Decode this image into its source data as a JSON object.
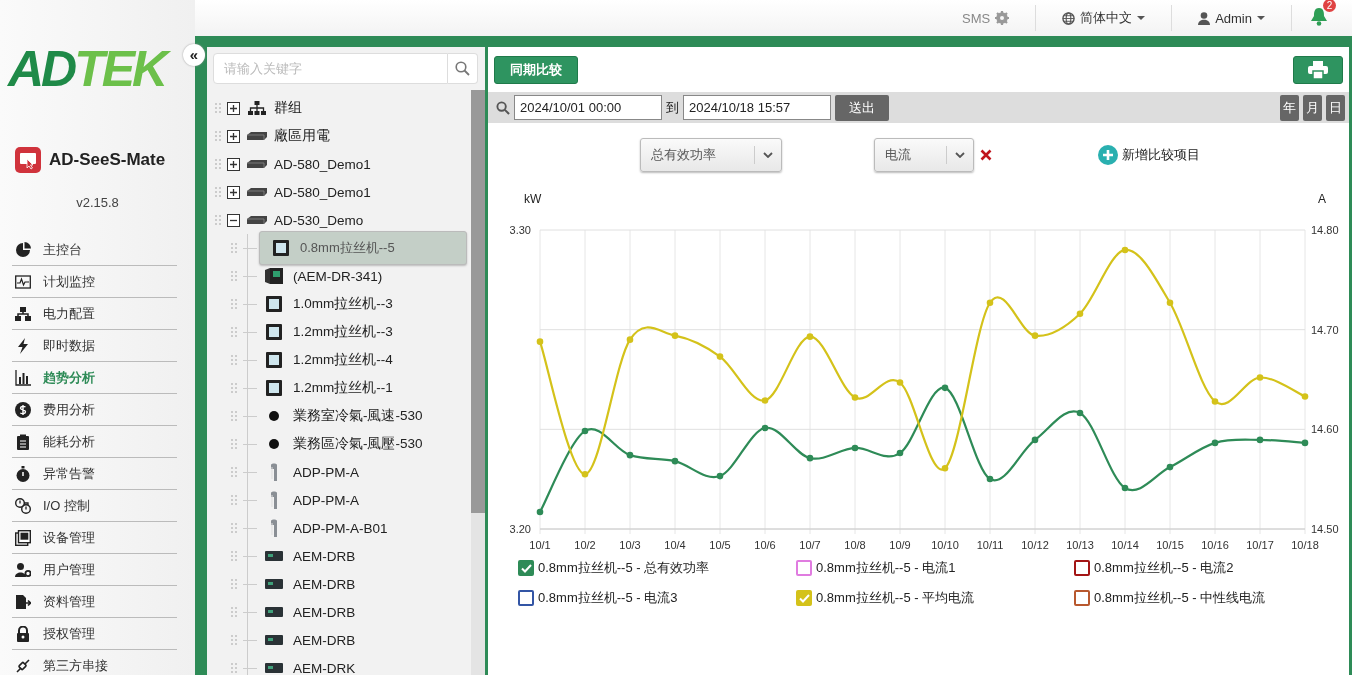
{
  "header": {
    "sms": "SMS",
    "language": "简体中文",
    "user": "Admin",
    "notifications": "2"
  },
  "sidebar": {
    "logo": [
      "AD",
      "TEK"
    ],
    "collapse": "«",
    "app_name": "AD-SeeS-Mate",
    "version": "v2.15.8",
    "items": [
      {
        "label": "主控台",
        "selected": false
      },
      {
        "label": "计划监控",
        "selected": false
      },
      {
        "label": "电力配置",
        "selected": false
      },
      {
        "label": "即时数据",
        "selected": false
      },
      {
        "label": "趋势分析",
        "selected": true
      },
      {
        "label": "费用分析",
        "selected": false
      },
      {
        "label": "能耗分析",
        "selected": false
      },
      {
        "label": "异常告警",
        "selected": false
      },
      {
        "label": "I/O 控制",
        "selected": false
      },
      {
        "label": "设备管理",
        "selected": false
      },
      {
        "label": "用户管理",
        "selected": false
      },
      {
        "label": "资料管理",
        "selected": false
      },
      {
        "label": "授权管理",
        "selected": false
      },
      {
        "label": "第三方串接",
        "selected": false
      }
    ]
  },
  "tree": {
    "search": {
      "placeholder": "请输入关键字"
    },
    "items": [
      {
        "label": "群组",
        "kind": "group",
        "expanded": false,
        "selected": false
      },
      {
        "label": "廠區用電",
        "kind": "device",
        "expanded": false,
        "selected": false
      },
      {
        "label": "AD-580_Demo1",
        "kind": "device",
        "expanded": false,
        "selected": false
      },
      {
        "label": "AD-580_Demo1",
        "kind": "device",
        "expanded": false,
        "selected": false
      },
      {
        "label": "AD-530_Demo",
        "kind": "device",
        "expanded": true,
        "selected": false,
        "children": [
          {
            "label": "0.8mm拉丝机--5",
            "kind": "meter",
            "selected": true
          },
          {
            "label": "(AEM-DR-341)",
            "kind": "panel",
            "selected": false
          },
          {
            "label": "1.0mm拉丝机--3",
            "kind": "meter",
            "selected": false
          },
          {
            "label": "1.2mm拉丝机--3",
            "kind": "meter",
            "selected": false
          },
          {
            "label": "1.2mm拉丝机--4",
            "kind": "meter",
            "selected": false
          },
          {
            "label": "1.2mm拉丝机--1",
            "kind": "meter",
            "selected": false
          },
          {
            "label": "業務室冷氣-風速-530",
            "kind": "dot",
            "selected": false
          },
          {
            "label": "業務區冷氣-風壓-530",
            "kind": "dot",
            "selected": false
          },
          {
            "label": "ADP-PM-A",
            "kind": "sensor",
            "selected": false
          },
          {
            "label": "ADP-PM-A",
            "kind": "sensor",
            "selected": false
          },
          {
            "label": "ADP-PM-A-B01",
            "kind": "sensor",
            "selected": false
          },
          {
            "label": "AEM-DRB",
            "kind": "module",
            "selected": false
          },
          {
            "label": "AEM-DRB",
            "kind": "module",
            "selected": false
          },
          {
            "label": "AEM-DRB",
            "kind": "module",
            "selected": false
          },
          {
            "label": "AEM-DRB",
            "kind": "module",
            "selected": false
          },
          {
            "label": "AEM-DRK",
            "kind": "module",
            "selected": false
          }
        ]
      }
    ]
  },
  "main": {
    "compare_button": "同期比较",
    "filter": {
      "from": "2024/10/01 00:00",
      "to_label": "到",
      "to": "2024/10/18 15:57",
      "submit": "送出",
      "periods": [
        "年",
        "月",
        "日"
      ]
    },
    "selectors": [
      {
        "value": "总有效功率",
        "removable": false
      },
      {
        "value": "电流",
        "removable": true
      }
    ],
    "add_item": "新增比较项目",
    "chart_data": {
      "type": "line",
      "grid": true,
      "ylabel": "kW",
      "y2label": "A",
      "ylim": [
        3.2,
        3.3
      ],
      "yticks": [
        {
          "value": 3.2,
          "label": "3.20"
        },
        {
          "value": 3.3,
          "label": "3.30"
        }
      ],
      "y2lim": [
        14.5,
        14.8
      ],
      "y2ticks": [
        {
          "value": 14.5,
          "label": "14.50"
        },
        {
          "value": 14.6,
          "label": "14.60"
        },
        {
          "value": 14.7,
          "label": "14.70"
        },
        {
          "value": 14.8,
          "label": "14.80"
        }
      ],
      "categories": [
        "10/1",
        "10/2",
        "10/3",
        "10/4",
        "10/5",
        "10/6",
        "10/7",
        "10/8",
        "10/9",
        "10/10",
        "10/11",
        "10/12",
        "10/13",
        "10/14",
        "10/15",
        "10/16",
        "10/17",
        "10/18"
      ],
      "series": [
        {
          "color": "#2e8b57",
          "marker": "circle",
          "values": [
            3.2057,
            3.2328,
            3.2247,
            3.2227,
            3.2177,
            3.2338,
            3.2237,
            3.2271,
            3.2254,
            3.2472,
            3.2167,
            3.2298,
            3.2388,
            3.2137,
            3.2207,
            3.2288,
            3.2298,
            3.2288
          ]
        },
        {
          "color": "#d4c21a",
          "axis": "y2",
          "marker": "circle",
          "values": [
            14.688,
            14.555,
            14.69,
            14.694,
            14.673,
            14.629,
            14.693,
            14.632,
            14.647,
            14.561,
            14.727,
            14.694,
            14.716,
            14.78,
            14.727,
            14.628,
            14.652,
            14.633
          ]
        }
      ]
    },
    "legend": [
      {
        "label": "0.8mm拉丝机--5 - 总有效功率",
        "color": "#2e8b57",
        "checked": true
      },
      {
        "label": "0.8mm拉丝机--5 - 电流1",
        "color": "#e07ce0",
        "checked": false
      },
      {
        "label": "0.8mm拉丝机--5 - 电流2",
        "color": "#a31515",
        "checked": false
      },
      {
        "label": "0.8mm拉丝机--5 - 电流3",
        "color": "#3355a5",
        "checked": false
      },
      {
        "label": "0.8mm拉丝机--5 - 平均电流",
        "color": "#d4c21a",
        "checked": true
      },
      {
        "label": "0.8mm拉丝机--5 - 中性线电流",
        "color": "#b8582e",
        "checked": false
      }
    ]
  }
}
